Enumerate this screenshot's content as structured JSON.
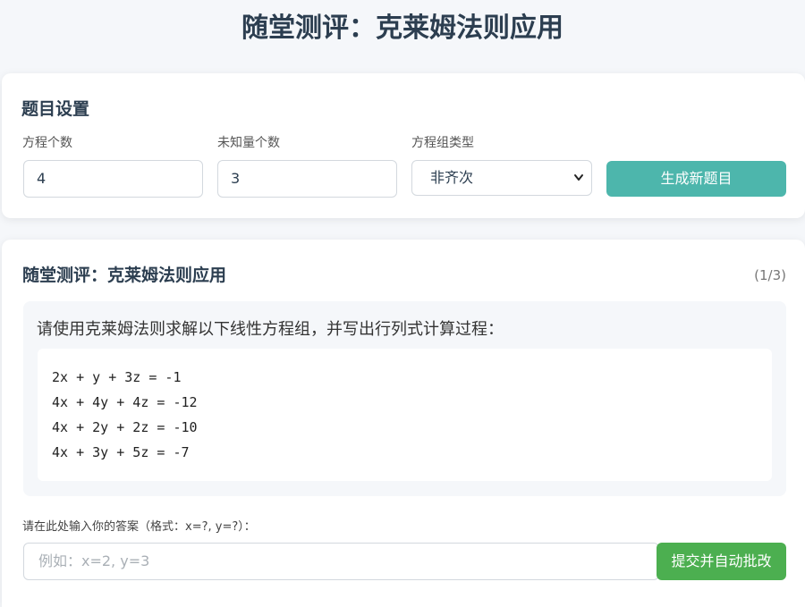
{
  "header": {
    "title": "随堂测评：克莱姆法则应用"
  },
  "settings": {
    "title": "题目设置",
    "equation_count_label": "方程个数",
    "equation_count_value": "4",
    "unknown_count_label": "未知量个数",
    "unknown_count_value": "3",
    "system_type_label": "方程组类型",
    "system_type_value": "非齐次",
    "generate_label": "生成新题目"
  },
  "quiz": {
    "title": "随堂测评：克莱姆法则应用",
    "progress": "(1/3)",
    "prompt": "请使用克莱姆法则求解以下线性方程组，并写出行列式计算过程：",
    "equations": [
      "2x + y + 3z = -1",
      "4x + 4y + 4z = -12",
      "4x + 2y + 2z = -10",
      "4x + 3y + 5z = -7"
    ],
    "answer_label": "请在此处输入你的答案（格式：x=?, y=?）：",
    "answer_placeholder": "例如：x=2, y=3",
    "submit_label": "提交并自动批改"
  },
  "colors": {
    "generate_button": "#4db6ac",
    "submit_button": "#4caf50",
    "background": "#f5f7fa"
  }
}
